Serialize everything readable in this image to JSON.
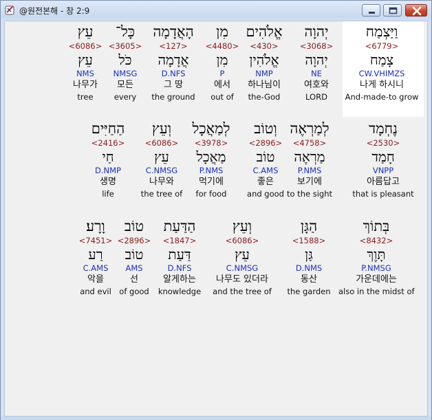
{
  "window": {
    "title": "@원전본해 - 창 2:9"
  },
  "rows": [
    [
      {
        "heb": "וַיַּצְמַח",
        "strong": "<6779>",
        "lemma": "צָמַח",
        "parse": "CW.VHIMZS",
        "kor": "나게 하시니",
        "eng": "And-made-to grow",
        "highlight": true
      },
      {
        "heb": "יְהוָה",
        "strong": "<3068>",
        "lemma": "יְהוָה",
        "parse": "NE",
        "kor": "여호와",
        "eng": "LORD"
      },
      {
        "heb": "אֱלֹהִים",
        "strong": "<430>",
        "lemma": "אֱלֹהִין",
        "parse": "NMP",
        "kor": "하나님이",
        "eng": "the-God"
      },
      {
        "heb": "מִן",
        "strong": "<4480>",
        "lemma": "מִן",
        "parse": "P",
        "kor": "에서",
        "eng": "out of"
      },
      {
        "heb": "הָאֲדָמָה",
        "strong": "<127>",
        "lemma": "אֲדָמָה",
        "parse": "D.NFS",
        "kor": "그 땅",
        "eng": "the ground"
      },
      {
        "heb": "כָּל־",
        "strong": "<3605>",
        "lemma": "כֹּל",
        "parse": "NMSG",
        "kor": "모든",
        "eng": "every"
      },
      {
        "heb": "עֵץ",
        "strong": "<6086>",
        "lemma": "עֵץ",
        "parse": "NMS",
        "kor": "나무가",
        "eng": "tree"
      }
    ],
    [
      {
        "heb": "נֶחְמָד",
        "strong": "<2530>",
        "lemma": "חָמַד",
        "parse": "VNPP",
        "kor": "아름답고",
        "eng": "that is pleasant"
      },
      {
        "heb": "לְמַרְאֶה",
        "strong": "<4758>",
        "lemma": "מַרְאֶה",
        "parse": "P.NMS",
        "kor": "보기에",
        "eng": "to the sight"
      },
      {
        "heb": "וְטוֹב",
        "strong": "<2896>",
        "lemma": "טוֹב",
        "parse": "C.AMS",
        "kor": "좋은",
        "eng": "and good"
      },
      {
        "heb": "לְמַאֲכָל",
        "strong": "<3978>",
        "lemma": "מַאֲכָל",
        "parse": "P.NMS",
        "kor": "먹기에",
        "eng": "for food"
      },
      {
        "heb": "וְעֵץ",
        "strong": "<6086>",
        "lemma": "עֵץ",
        "parse": "C.NMSG",
        "kor": "나무와",
        "eng": "the tree of"
      },
      {
        "heb": "הַחַיִּים",
        "strong": "<2416>",
        "lemma": "חַי",
        "parse": "D.NMP",
        "kor": "생명",
        "eng": "life"
      }
    ],
    [
      {
        "heb": "בְּתוֹךְ",
        "strong": "<8432>",
        "lemma": "תָּוֶךְ",
        "parse": "P.NMSG",
        "kor": "가운데에는",
        "eng": "also in the midst of"
      },
      {
        "heb": "הַגָּן",
        "strong": "<1588>",
        "lemma": "גַּן",
        "parse": "D.NMS",
        "kor": "동산",
        "eng": "the garden"
      },
      {
        "heb": "וְעֵץ",
        "strong": "<6086>",
        "lemma": "עֵץ",
        "parse": "C.NMSG",
        "kor": "나무도 있더라",
        "eng": "and the tree of"
      },
      {
        "heb": "הַדַּעַת",
        "strong": "<1847>",
        "lemma": "דַּעַת",
        "parse": "D.NFS",
        "kor": "알게하는",
        "eng": "knowledge"
      },
      {
        "heb": "טוֹב",
        "strong": "<2896>",
        "lemma": "טוֹב",
        "parse": "AMS",
        "kor": "선",
        "eng": "of good"
      },
      {
        "heb": "וָרָע׃",
        "strong": "<7451>",
        "lemma": "רַע",
        "parse": "C.AMS",
        "kor": "악을",
        "eng": "and evil"
      }
    ]
  ],
  "colors": {
    "strong": "#8b1a1a",
    "parse": "#1a2fb8",
    "highlight": "#ffffff"
  },
  "icons": {
    "app": "bible-app-icon",
    "minimize": "minimize-icon",
    "maximize": "maximize-icon",
    "close": "close-icon"
  }
}
